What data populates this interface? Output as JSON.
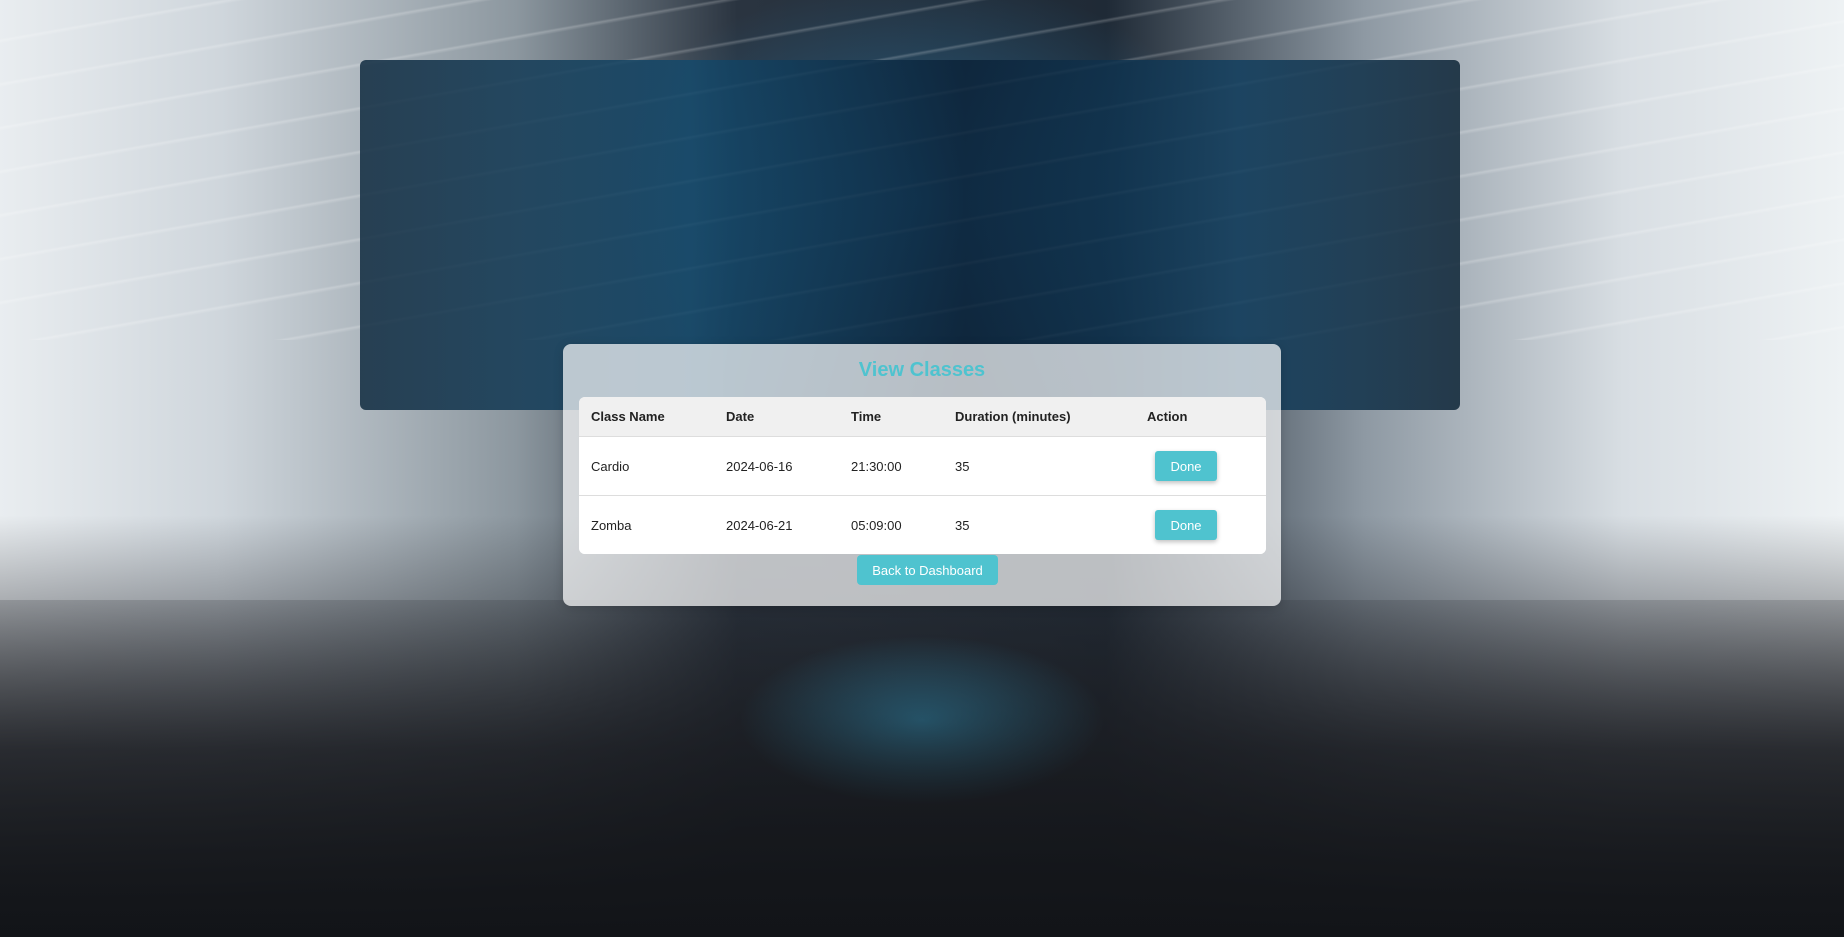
{
  "page": {
    "title": "View Classes",
    "accent_color": "#4fc3cf",
    "background": "gym-interior-photo"
  },
  "table": {
    "headers": [
      "Class Name",
      "Date",
      "Time",
      "Duration (minutes)",
      "Action"
    ],
    "rows": [
      {
        "class_name": "Cardio",
        "date": "2024-06-16",
        "time": "21:30:00",
        "duration": "35",
        "action_label": "Done"
      },
      {
        "class_name": "Zomba",
        "date": "2024-06-21",
        "time": "05:09:00",
        "duration": "35",
        "action_label": "Done"
      }
    ]
  },
  "footer": {
    "back_label": "Back to Dashboard"
  }
}
